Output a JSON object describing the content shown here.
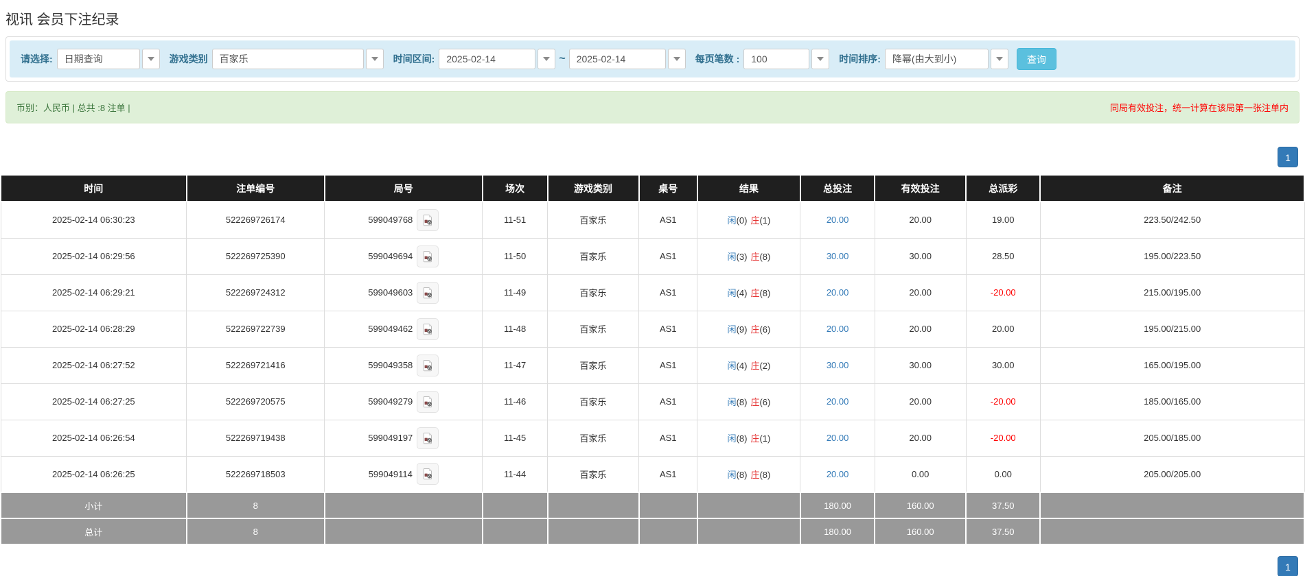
{
  "page_title": "视讯 会员下注纪录",
  "filters": {
    "selector": {
      "label": "请选择:",
      "value": "日期查询"
    },
    "game_type": {
      "label": "游戏类别",
      "value": "百家乐"
    },
    "time_range": {
      "label": "时间区间:",
      "from": "2025-02-14",
      "separator": "~",
      "to": "2025-02-14"
    },
    "page_size": {
      "label": "每页笔数 :",
      "value": "100"
    },
    "sort": {
      "label": "时间排序:",
      "value": "降幂(由大到小)"
    },
    "search_button": "查询"
  },
  "summary": {
    "currency_info": "币别：人民币 | 总共 :8 注单 |",
    "notice": "同局有效投注，统一计算在该局第一张注单内"
  },
  "pagination": {
    "page": "1"
  },
  "table": {
    "headers": [
      "时间",
      "注单编号",
      "局号",
      "场次",
      "游戏类别",
      "桌号",
      "结果",
      "总投注",
      "有效投注",
      "总派彩",
      "备注"
    ],
    "rows": [
      {
        "time": "2025-02-14 06:30:23",
        "bet_id": "522269726174",
        "round_id": "599049768",
        "session": "11-51",
        "game": "百家乐",
        "table_no": "AS1",
        "result_player": "闲",
        "result_player_n": "(0)",
        "result_banker": "庄",
        "result_banker_n": "(1)",
        "total_bet": "20.00",
        "valid_bet": "20.00",
        "payout": "19.00",
        "note": "223.50/242.50"
      },
      {
        "time": "2025-02-14 06:29:56",
        "bet_id": "522269725390",
        "round_id": "599049694",
        "session": "11-50",
        "game": "百家乐",
        "table_no": "AS1",
        "result_player": "闲",
        "result_player_n": "(3)",
        "result_banker": "庄",
        "result_banker_n": "(8)",
        "total_bet": "30.00",
        "valid_bet": "30.00",
        "payout": "28.50",
        "note": "195.00/223.50"
      },
      {
        "time": "2025-02-14 06:29:21",
        "bet_id": "522269724312",
        "round_id": "599049603",
        "session": "11-49",
        "game": "百家乐",
        "table_no": "AS1",
        "result_player": "闲",
        "result_player_n": "(4)",
        "result_banker": "庄",
        "result_banker_n": "(8)",
        "total_bet": "20.00",
        "valid_bet": "20.00",
        "payout": "-20.00",
        "note": "215.00/195.00"
      },
      {
        "time": "2025-02-14 06:28:29",
        "bet_id": "522269722739",
        "round_id": "599049462",
        "session": "11-48",
        "game": "百家乐",
        "table_no": "AS1",
        "result_player": "闲",
        "result_player_n": "(9)",
        "result_banker": "庄",
        "result_banker_n": "(6)",
        "total_bet": "20.00",
        "valid_bet": "20.00",
        "payout": "20.00",
        "note": "195.00/215.00"
      },
      {
        "time": "2025-02-14 06:27:52",
        "bet_id": "522269721416",
        "round_id": "599049358",
        "session": "11-47",
        "game": "百家乐",
        "table_no": "AS1",
        "result_player": "闲",
        "result_player_n": "(4)",
        "result_banker": "庄",
        "result_banker_n": "(2)",
        "total_bet": "30.00",
        "valid_bet": "30.00",
        "payout": "30.00",
        "note": "165.00/195.00"
      },
      {
        "time": "2025-02-14 06:27:25",
        "bet_id": "522269720575",
        "round_id": "599049279",
        "session": "11-46",
        "game": "百家乐",
        "table_no": "AS1",
        "result_player": "闲",
        "result_player_n": "(8)",
        "result_banker": "庄",
        "result_banker_n": "(6)",
        "total_bet": "20.00",
        "valid_bet": "20.00",
        "payout": "-20.00",
        "note": "185.00/165.00"
      },
      {
        "time": "2025-02-14 06:26:54",
        "bet_id": "522269719438",
        "round_id": "599049197",
        "session": "11-45",
        "game": "百家乐",
        "table_no": "AS1",
        "result_player": "闲",
        "result_player_n": "(8)",
        "result_banker": "庄",
        "result_banker_n": "(1)",
        "total_bet": "20.00",
        "valid_bet": "20.00",
        "payout": "-20.00",
        "note": "205.00/185.00"
      },
      {
        "time": "2025-02-14 06:26:25",
        "bet_id": "522269718503",
        "round_id": "599049114",
        "session": "11-44",
        "game": "百家乐",
        "table_no": "AS1",
        "result_player": "闲",
        "result_player_n": "(8)",
        "result_banker": "庄",
        "result_banker_n": "(8)",
        "total_bet": "20.00",
        "valid_bet": "0.00",
        "payout": "0.00",
        "note": "205.00/205.00"
      }
    ],
    "footer": {
      "subtotal": {
        "label": "小计",
        "count": "8",
        "total_bet": "180.00",
        "valid_bet": "160.00",
        "payout": "37.50"
      },
      "total": {
        "label": "总计",
        "count": "8",
        "total_bet": "180.00",
        "valid_bet": "160.00",
        "payout": "37.50"
      }
    }
  },
  "colors": {
    "filter_bar_bg": "#d9edf7",
    "summary_bg": "#dff0d8",
    "summary_text": "#3c763d",
    "notice_text": "#ff0000",
    "header_bg": "#1f1f1f",
    "footer_bg": "#999999",
    "link_blue": "#337ab7",
    "banker_red": "#e53333",
    "negative_red": "#ff0000",
    "search_button_bg": "#5bc0de",
    "pagination_bg": "#337ab7"
  }
}
